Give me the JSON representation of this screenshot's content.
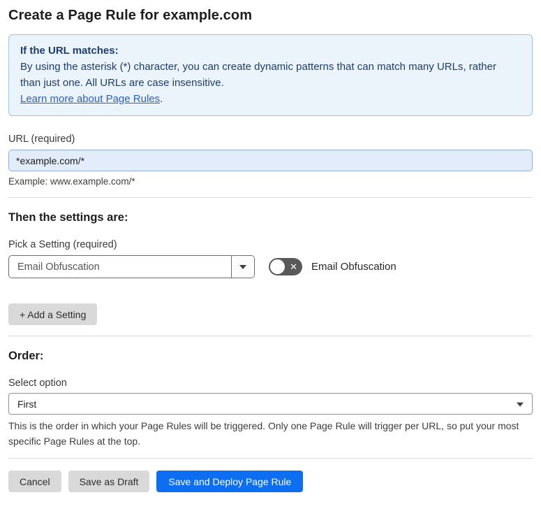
{
  "page": {
    "title": "Create a Page Rule for example.com"
  },
  "info_box": {
    "heading": "If the URL matches:",
    "body": "By using the asterisk (*) character, you can create dynamic patterns that can match many URLs, rather than just one. All URLs are case insensitive.",
    "link_label": "Learn more about Page Rules",
    "link_suffix": "."
  },
  "url_field": {
    "label": "URL (required)",
    "value": "*example.com/*",
    "example": "Example: www.example.com/*"
  },
  "settings_section": {
    "heading": "Then the settings are:",
    "picker_label": "Pick a Setting (required)",
    "picker_value": "Email Obfuscation",
    "toggle_label": "Email Obfuscation",
    "toggle_state": "off",
    "add_button_label": "+ Add a Setting"
  },
  "order_section": {
    "heading": "Order:",
    "select_label": "Select option",
    "select_value": "First",
    "help_text": "This is the order in which your Page Rules will be triggered. Only one Page Rule will trigger per URL, so put your most specific Page Rules at the top."
  },
  "footer": {
    "cancel_label": "Cancel",
    "save_draft_label": "Save as Draft",
    "save_deploy_label": "Save and Deploy Page Rule"
  },
  "colors": {
    "accent_blue": "#0d6ef2",
    "info_background": "#ebf3fb",
    "info_border": "#9ec3e6",
    "info_text": "#1e3d6b",
    "link_blue": "#2b5fc7",
    "input_background": "#e3ecfb",
    "toggle_off_gray": "#595959",
    "button_gray": "#d9d9d9"
  }
}
